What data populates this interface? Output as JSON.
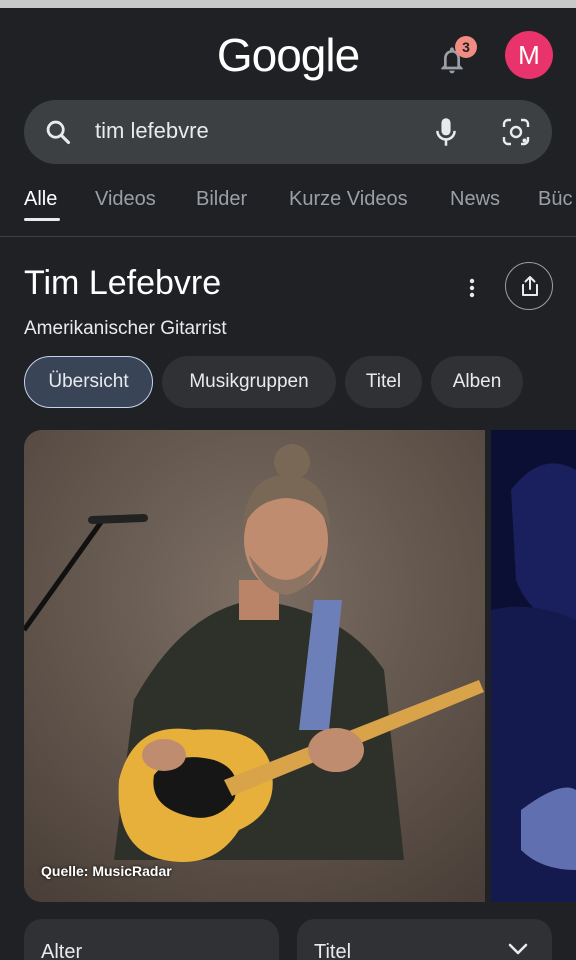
{
  "header": {
    "logo_text": "Google",
    "notification_count": "3",
    "avatar_letter": "M"
  },
  "search": {
    "query": "tim lefebvre"
  },
  "tabs": [
    "Alle",
    "Videos",
    "Bilder",
    "Kurze Videos",
    "News",
    "Büc"
  ],
  "active_tab": "Alle",
  "knowledge_panel": {
    "title": "Tim Lefebvre",
    "subtitle": "Amerikanischer Gitarrist",
    "chips": [
      "Übersicht",
      "Musikgruppen",
      "Titel",
      "Alben"
    ],
    "active_chip": "Übersicht",
    "image_source": "Quelle: MusicRadar"
  },
  "cards": [
    "Alter",
    "Titel"
  ],
  "colors": {
    "background": "#202124",
    "search_bar": "#3c4043",
    "avatar": "#e8336d",
    "badge": "#f28b82",
    "active_chip_bg": "#394457"
  },
  "icons": [
    "search-icon",
    "mic-icon",
    "lens-icon",
    "bell-icon",
    "more-vert-icon",
    "share-icon",
    "chevron-down-icon"
  ]
}
